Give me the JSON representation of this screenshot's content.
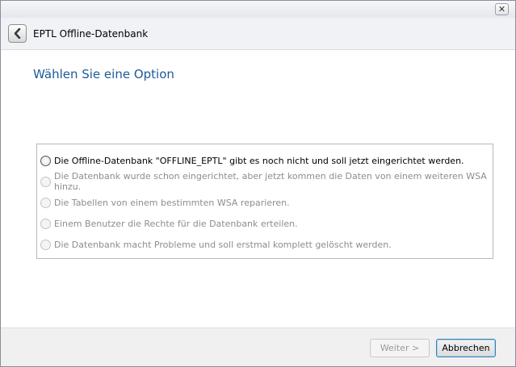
{
  "window": {
    "close_glyph": "✕"
  },
  "nav": {
    "title": "EPTL Offline-Datenbank"
  },
  "content": {
    "heading": "Wählen Sie eine Option",
    "options": [
      {
        "label": "Die Offline-Datenbank \"OFFLINE_EPTL\" gibt es noch nicht und soll jetzt eingerichtet werden.",
        "enabled": true
      },
      {
        "label": "Die Datenbank wurde schon eingerichtet, aber jetzt kommen die Daten von einem weiteren WSA hinzu.",
        "enabled": false
      },
      {
        "label": "Die Tabellen von einem bestimmten WSA reparieren.",
        "enabled": false
      },
      {
        "label": "Einem Benutzer die Rechte für die Datenbank erteilen.",
        "enabled": false
      },
      {
        "label": "Die Datenbank macht Probleme und soll erstmal komplett gelöscht werden.",
        "enabled": false
      }
    ]
  },
  "footer": {
    "next_label": "Weiter >",
    "cancel_label": "Abbrechen"
  },
  "colors": {
    "heading": "#1e5a96",
    "disabled_text": "#8d8d8d"
  }
}
